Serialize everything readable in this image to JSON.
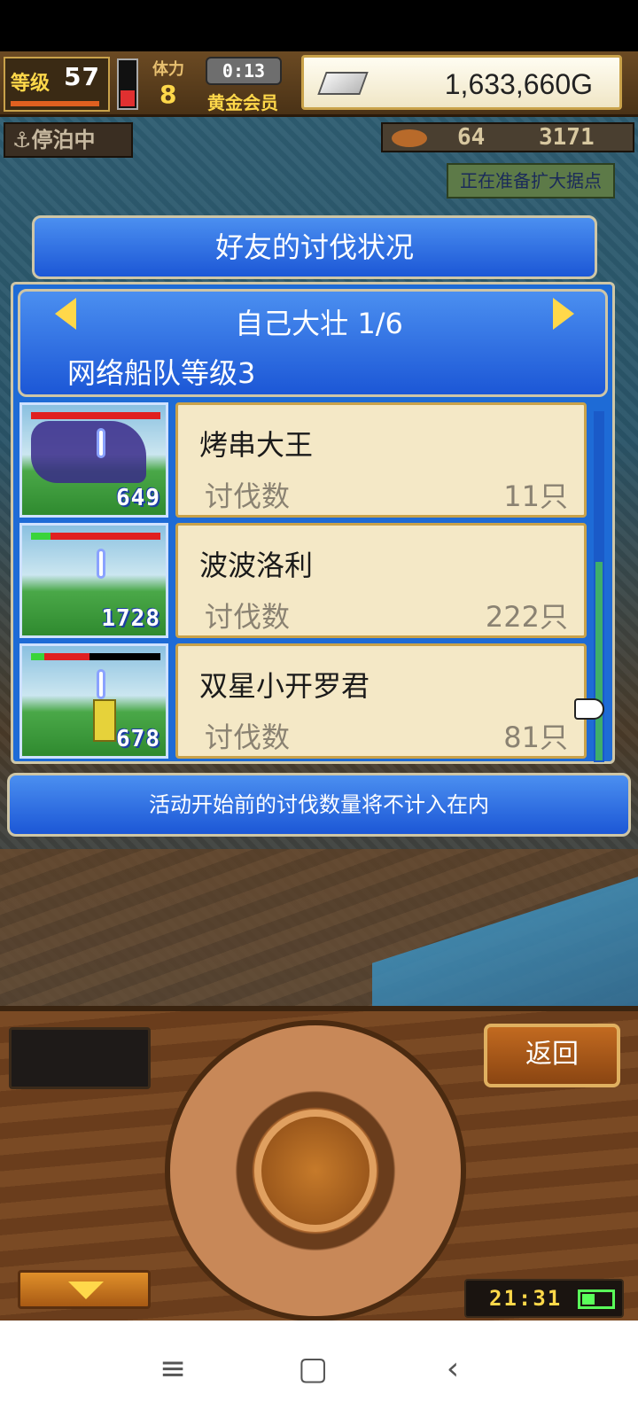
{
  "hud": {
    "level_label": "等级",
    "level": "57",
    "hp_fraction": 0.35,
    "stamina_label": "体力",
    "stamina": "8",
    "timer": "0:13",
    "vip": "黄金会员",
    "money": "1,633,660G"
  },
  "status": {
    "docked": "⚓停泊中",
    "resource_a": "64",
    "resource_b": "3171",
    "notice": "正在准备扩大据点"
  },
  "dialog": {
    "title": "好友的讨伐状况",
    "friend": "自己大壮 1/6",
    "fleet_level": "网络船队等级3",
    "rows": [
      {
        "name": "烤串大王",
        "label": "讨伐数",
        "value": "11只",
        "damage": "649",
        "hp_green": 0.0,
        "hp_red": 1.0
      },
      {
        "name": "波波洛利",
        "label": "讨伐数",
        "value": "222只",
        "damage": "1728",
        "hp_green": 0.15,
        "hp_red": 0.85
      },
      {
        "name": "双星小开罗君",
        "label": "讨伐数",
        "value": "81只",
        "damage": "678",
        "hp_green": 0.1,
        "hp_red": 0.35
      }
    ],
    "footer": "活动开始前的讨伐数量将不计入在内"
  },
  "panel": {
    "back_label": "返回",
    "clock": "21:31"
  },
  "icons": {
    "nav_menu": "≡",
    "nav_home": "▢",
    "nav_back": "‹"
  },
  "colors": {
    "dialog_blue": "#1c57d6",
    "card_bg": "#f4e8c6",
    "gold": "#ffd84a"
  }
}
